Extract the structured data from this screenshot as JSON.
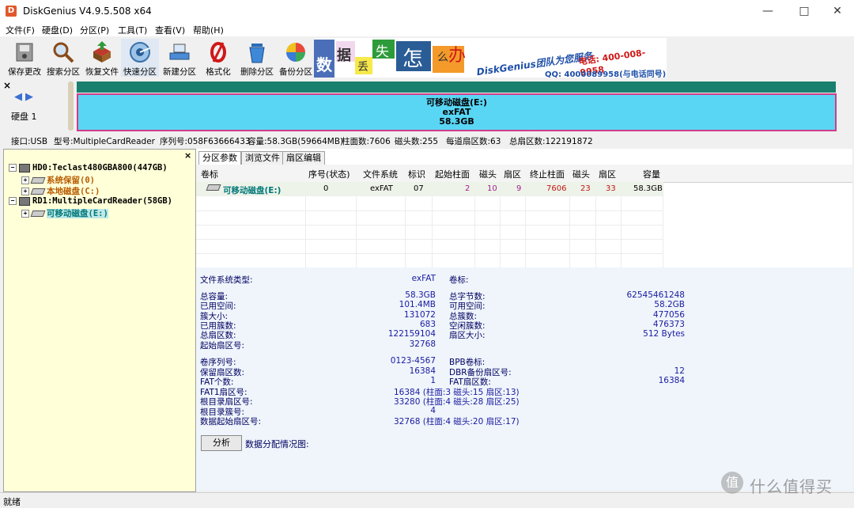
{
  "window": {
    "title": "DiskGenius V4.9.5.508 x64",
    "app_icon": "D"
  },
  "menu": [
    "文件(F)",
    "硬盘(D)",
    "分区(P)",
    "工具(T)",
    "查看(V)",
    "帮助(H)"
  ],
  "toolbar": {
    "save": "保存更改",
    "search": "搜索分区",
    "recover": "恢复文件",
    "quick": "快速分区",
    "new": "新建分区",
    "format": "格式化",
    "delete": "删除分区",
    "backup": "备份分区"
  },
  "banner": {
    "chars": [
      "数",
      "据",
      "丢",
      "失",
      "怎",
      "么",
      "办"
    ],
    "slogan": "DiskGenius团队为您服务",
    "phone": "电话: 400-008-9958",
    "qq": "QQ: 4000089958(与电话同号)"
  },
  "diskbar": {
    "disk_label": "硬盘 1",
    "partition_name": "可移动磁盘(E:)",
    "partition_fs": "exFAT",
    "partition_size": "58.3GB"
  },
  "infoline": {
    "iface": "接口:USB",
    "model": "型号:MultipleCardReader",
    "serial": "序列号:058F63666433",
    "capacity": "容量:58.3GB(59664MB)",
    "cylinders": "柱面数:7606",
    "heads": "磁头数:255",
    "sectors_per_track": "每道扇区数:63",
    "total_sectors": "总扇区数:122191872"
  },
  "tree": {
    "hd0": "HD0:Teclast480GBA800(447GB)",
    "hd0_p0": "系统保留(0)",
    "hd0_p1": "本地磁盘(C:)",
    "rd1": "RD1:MultipleCardReader(58GB)",
    "rd1_p0": "可移动磁盘(E:)"
  },
  "tabs": [
    "分区参数",
    "浏览文件",
    "扇区编辑"
  ],
  "table": {
    "headers": [
      "卷标",
      "序号(状态)",
      "文件系统",
      "标识",
      "起始柱面",
      "磁头",
      "扇区",
      "终止柱面",
      "磁头",
      "扇区",
      "容量"
    ],
    "row": [
      "可移动磁盘(E:)",
      "0",
      "exFAT",
      "07",
      "2",
      "10",
      "9",
      "7606",
      "23",
      "33",
      "58.3GB"
    ]
  },
  "params": {
    "fs_type_k": "文件系统类型:",
    "fs_type_v": "exFAT",
    "vol_label_k": "卷标:",
    "total_cap_k": "总容量:",
    "total_cap_v": "58.3GB",
    "used_k": "已用空间:",
    "used_v": "101.4MB",
    "cluster_k": "簇大小:",
    "cluster_v": "131072",
    "used_clusters_k": "已用簇数:",
    "used_clusters_v": "683",
    "total_sectors_k": "总扇区数:",
    "total_sectors_v": "122159104",
    "start_sector_k": "起始扇区号:",
    "start_sector_v": "32768",
    "total_bytes_k": "总字节数:",
    "total_bytes_v": "62545461248",
    "free_k": "可用空间:",
    "free_v": "58.2GB",
    "total_clusters_k": "总簇数:",
    "total_clusters_v": "477056",
    "free_clusters_k": "空闲簇数:",
    "free_clusters_v": "476373",
    "sector_size_k": "扇区大小:",
    "sector_size_v": "512 Bytes",
    "serial_k": "卷序列号:",
    "serial_v": "0123-4567",
    "reserved_k": "保留扇区数:",
    "reserved_v": "16384",
    "fat_count_k": "FAT个数:",
    "fat_count_v": "1",
    "fat1_k": "FAT1扇区号:",
    "fat1_v": "16384 (柱面:3 磁头:15 扇区:13)",
    "rootdir_k": "根目录扇区号:",
    "rootdir_v": "33280 (柱面:4 磁头:28 扇区:25)",
    "rootcluster_k": "根目录簇号:",
    "rootcluster_v": "4",
    "datastart_k": "数据起始扇区号:",
    "datastart_v": "32768 (柱面:4 磁头:20 扇区:17)",
    "bpb_k": "BPB卷标:",
    "dbr_k": "DBR备份扇区号:",
    "dbr_v": "12",
    "fat_sectors_k": "FAT扇区数:",
    "fat_sectors_v": "16384"
  },
  "analyze_button": "分析",
  "distribution_label": "数据分配情况图:",
  "status": "就绪",
  "watermark": "什么值得买",
  "watermark_icon": "值"
}
